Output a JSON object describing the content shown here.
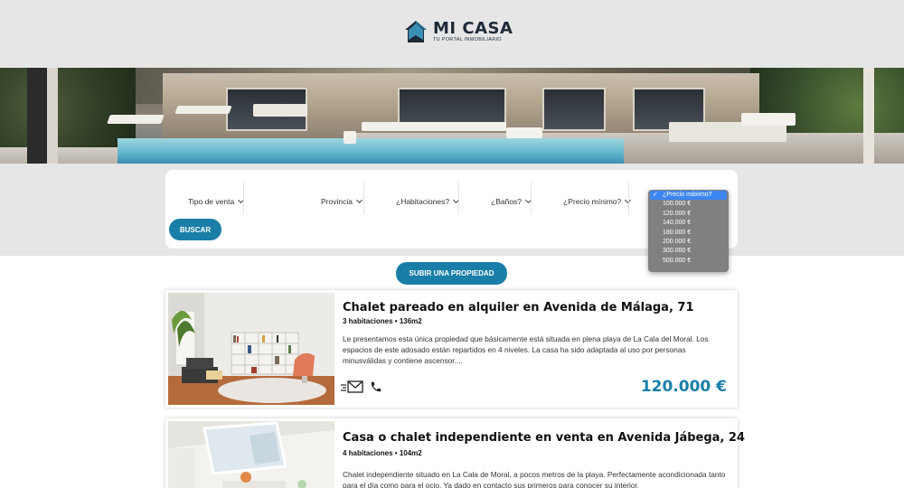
{
  "brand": {
    "name": "MI CASA",
    "tagline": "TU PORTAL INMOBILIARIO"
  },
  "colors": {
    "accent": "#1a7fa8",
    "header_bg": "#e6e6e6",
    "dropdown_bg": "#808080",
    "dropdown_selected": "#3d86f2"
  },
  "search": {
    "filters": [
      {
        "label": "Tipo de venta"
      },
      {
        "label": "Provincia"
      },
      {
        "label": "¿Habitaciones?"
      },
      {
        "label": "¿Baños?"
      },
      {
        "label": "¿Precio mínimo?"
      }
    ],
    "submit_label": "BUSCAR",
    "max_price_dropdown": {
      "selected": "¿Precio máximo?",
      "options": [
        "100.000 €",
        "120.000 €",
        "140.000 €",
        "180.000 €",
        "200.000 €",
        "300.000 €",
        "500.000 €"
      ]
    }
  },
  "upload_label": "SUBIR UNA PROPIEDAD",
  "listings": [
    {
      "title": "Chalet pareado en alquiler en Avenida de Málaga, 71",
      "meta": "3 habitaciones • 136m2",
      "description": "Le presentamos esta única propiedad que básicamente está situada en plena playa de La Cala del Moral. Los espacios de este adosado están repartidos en 4 niveles. La casa ha sido adaptada al uso por personas minusválidas y contiene ascensor....",
      "price": "120.000 €",
      "actions": [
        "email-icon",
        "phone-icon"
      ]
    },
    {
      "title": "Casa o chalet independiente en venta en Avenida Jábega, 24",
      "meta": "4 habitaciones • 104m2",
      "description": "Chalet independiente situado en La Cala de Moral, a pocos metros de la playa. Perfectamente acondicionada tanto para el día como para el ocio. Ya dado en contacto sus primeros para conocer su interior."
    }
  ]
}
